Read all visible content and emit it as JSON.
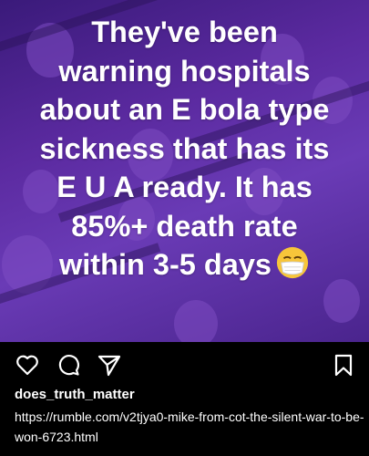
{
  "post": {
    "caption_lines": [
      "They've been",
      "warning hospitals",
      "about an E bola type",
      "sickness that has its",
      "E U A ready. It has",
      "85%+ death rate",
      "within 3-5 days"
    ],
    "emoji": "face-with-medical-mask",
    "background_colors": [
      "#3a1a7a",
      "#6a3bb6",
      "#4a248d"
    ]
  },
  "actions": {
    "like_icon": "heart-outline-icon",
    "comment_icon": "comment-bubble-icon",
    "share_icon": "paper-plane-icon",
    "save_icon": "bookmark-icon"
  },
  "author": {
    "username": "does_truth_matter"
  },
  "description": {
    "link": "https://rumble.com/v2tjya0-mike-from-cot-the-silent-war-to-be-won-6723.html"
  }
}
